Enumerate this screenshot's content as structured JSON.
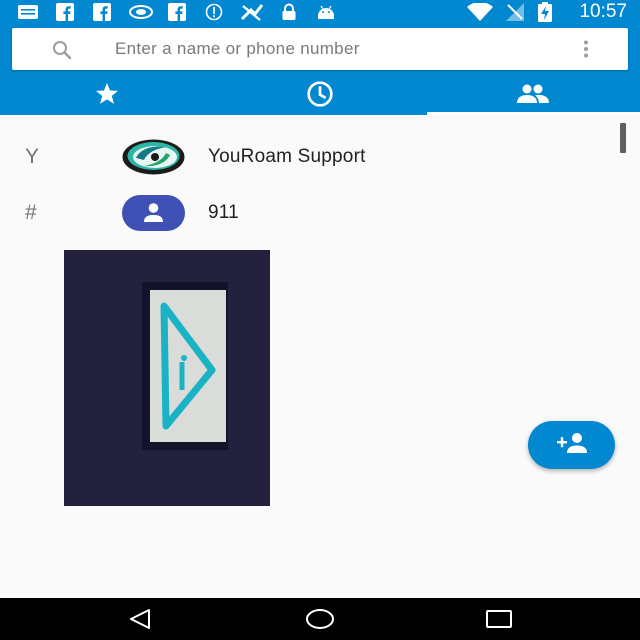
{
  "status_bar": {
    "time": "10:57",
    "left_icons": [
      "message-icon",
      "facebook-icon",
      "facebook-icon",
      "nvidia-icon",
      "facebook-icon",
      "circle-info-icon",
      "vpn-icon",
      "lock-icon",
      "android-icon"
    ],
    "right_icons": [
      "wifi-icon",
      "no-sim-icon",
      "battery-charging-icon"
    ]
  },
  "search": {
    "placeholder": "Enter a name or phone number"
  },
  "tabs": [
    {
      "name": "favorites",
      "icon": "star-icon",
      "selected": false
    },
    {
      "name": "recents",
      "icon": "clock-icon",
      "selected": false
    },
    {
      "name": "contacts",
      "icon": "people-icon",
      "selected": true
    }
  ],
  "contacts": [
    {
      "section_letter": "Y",
      "name": "YouRoam Support",
      "avatar": "youroam-logo-icon"
    },
    {
      "section_letter": "#",
      "name": "911",
      "avatar": "default-person-icon"
    }
  ],
  "fab": {
    "icon": "add-contact-icon"
  },
  "colors": {
    "primary": "#0288d1",
    "avatar_default": "#3f51b5",
    "background": "#fafafa",
    "preview_bg": "#24213f",
    "preview_accent": "#1ab3c5"
  },
  "nav": [
    "back-icon",
    "home-icon",
    "recents-square-icon"
  ]
}
